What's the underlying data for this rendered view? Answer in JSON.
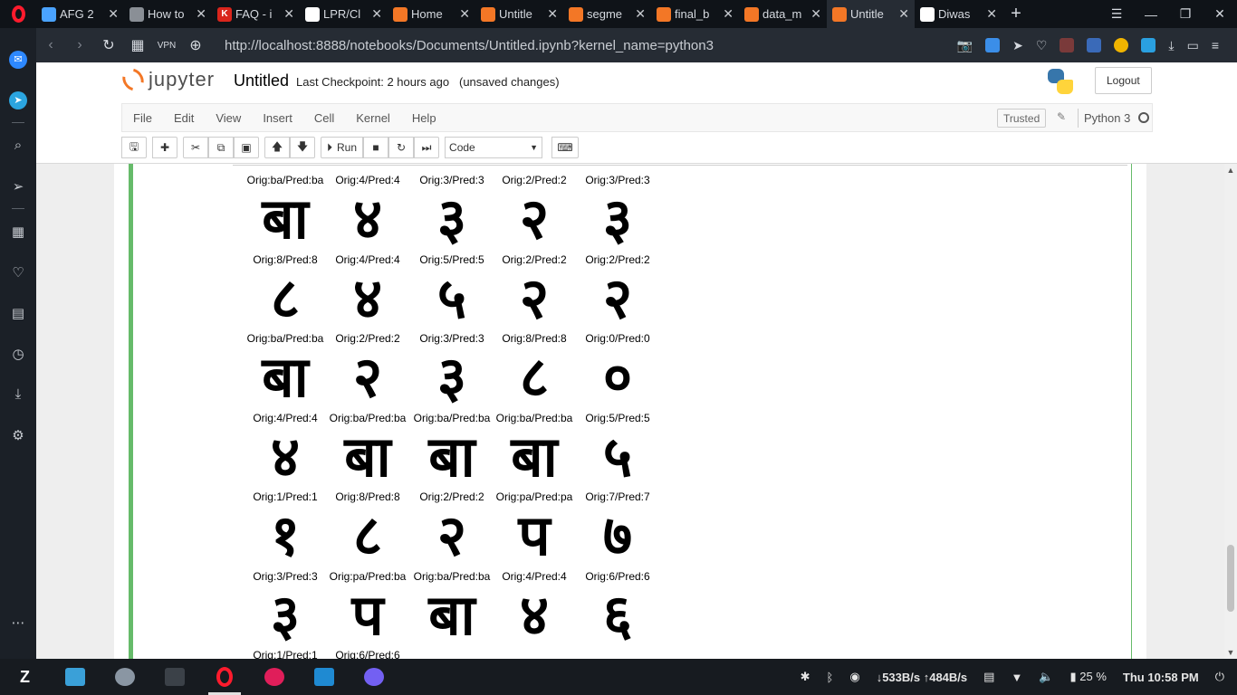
{
  "browser": {
    "tabs": [
      {
        "title": "AFG 2",
        "fav": "#4aa3ff",
        "glyph": "",
        "active": false
      },
      {
        "title": "How to",
        "fav": "#8a8f96",
        "glyph": "",
        "active": false
      },
      {
        "title": "FAQ - i",
        "fav": "#d9251c",
        "glyph": "K",
        "active": false
      },
      {
        "title": "LPR/Cl",
        "fav": "#ffffff",
        "glyph": "",
        "active": false
      },
      {
        "title": "Home",
        "fav": "#f37726",
        "glyph": "",
        "active": false
      },
      {
        "title": "Untitle",
        "fav": "#f37726",
        "glyph": "",
        "active": false
      },
      {
        "title": "segme",
        "fav": "#f37726",
        "glyph": "",
        "active": false
      },
      {
        "title": "final_b",
        "fav": "#f37726",
        "glyph": "",
        "active": false
      },
      {
        "title": "data_m",
        "fav": "#f37726",
        "glyph": "",
        "active": false
      },
      {
        "title": "Untitle",
        "fav": "#f37726",
        "glyph": "",
        "active": true
      },
      {
        "title": "Diwas",
        "fav": "#ffffff",
        "glyph": "",
        "active": false
      }
    ],
    "url": "http://localhost:8888/notebooks/Documents/Untitled.ipynb?kernel_name=python3"
  },
  "jupyter": {
    "logo_text": "jupyter",
    "notebook_name": "Untitled",
    "checkpoint": "Last Checkpoint: 2 hours ago",
    "unsaved": "(unsaved changes)",
    "logout": "Logout",
    "menus": [
      "File",
      "Edit",
      "View",
      "Insert",
      "Cell",
      "Kernel",
      "Help"
    ],
    "trusted": "Trusted",
    "kernel": "Python 3",
    "run_label": "Run",
    "cell_type": "Code"
  },
  "output": {
    "rows": [
      [
        "Orig:ba/Pred:ba",
        "Orig:4/Pred:4",
        "Orig:3/Pred:3",
        "Orig:2/Pred:2",
        "Orig:3/Pred:3"
      ],
      [
        "Orig:8/Pred:8",
        "Orig:4/Pred:4",
        "Orig:5/Pred:5",
        "Orig:2/Pred:2",
        "Orig:2/Pred:2"
      ],
      [
        "Orig:ba/Pred:ba",
        "Orig:2/Pred:2",
        "Orig:3/Pred:3",
        "Orig:8/Pred:8",
        "Orig:0/Pred:0"
      ],
      [
        "Orig:4/Pred:4",
        "Orig:ba/Pred:ba",
        "Orig:ba/Pred:ba",
        "Orig:ba/Pred:ba",
        "Orig:5/Pred:5"
      ],
      [
        "Orig:1/Pred:1",
        "Orig:8/Pred:8",
        "Orig:2/Pred:2",
        "Orig:pa/Pred:pa",
        "Orig:7/Pred:7"
      ],
      [
        "Orig:3/Pred:3",
        "Orig:pa/Pred:ba",
        "Orig:ba/Pred:ba",
        "Orig:4/Pred:4",
        "Orig:6/Pred:6"
      ],
      [
        "Orig:1/Pred:1",
        "Orig:6/Pred:6"
      ]
    ],
    "glyphs": [
      [
        "बा",
        "४",
        "३",
        "२",
        "३"
      ],
      [
        "८",
        "४",
        "५",
        "२",
        "२"
      ],
      [
        "बा",
        "२",
        "३",
        "८",
        "०"
      ],
      [
        "४",
        "बा",
        "बा",
        "बा",
        "५"
      ],
      [
        "१",
        "८",
        "२",
        "प",
        "७"
      ],
      [
        "३",
        "प",
        "बा",
        "४",
        "६"
      ]
    ]
  },
  "taskbar": {
    "network": "↓533B/s ↑484B/s",
    "battery": "25 %",
    "clock": "Thu 10:58 PM"
  }
}
